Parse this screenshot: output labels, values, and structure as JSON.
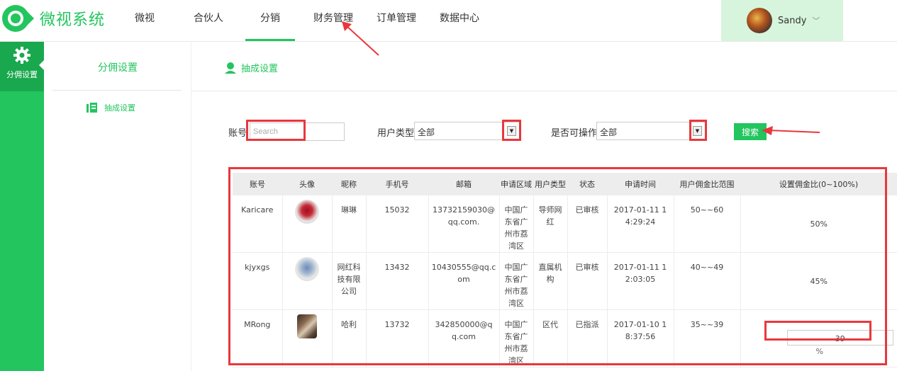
{
  "header": {
    "logo_text": "微视系统",
    "nav": [
      "微视",
      "合伙人",
      "分销",
      "财务管理",
      "订单管理",
      "数据中心"
    ],
    "user_name": "Sandy"
  },
  "sidebar": {
    "item_label": "分佣设置"
  },
  "subnav": {
    "title": "分佣设置",
    "item_label": "抽成设置"
  },
  "main": {
    "section_title": "抽成设置"
  },
  "filter": {
    "account_label": "账号",
    "account_placeholder": "Search",
    "user_type_label": "用户类型",
    "user_type_value": "全部",
    "operable_label": "是否可操作",
    "operable_value": "全部",
    "search_button": "搜索"
  },
  "table": {
    "columns": [
      "账号",
      "头像",
      "昵称",
      "手机号",
      "邮箱",
      "申请区域",
      "用户类型",
      "状态",
      "申请时间",
      "用户佣金比范围",
      "设置佣金比(0~100%)"
    ],
    "rows": [
      {
        "account": "Karicare",
        "nickname": "琳琳",
        "phone": "15032",
        "email": "13732159030@qq.com.",
        "region": "中国广东省广州市荔湾区",
        "user_type": "导师网红",
        "status": "已审核",
        "time": "2017-01-11 14:29:24",
        "range": "50~~60",
        "ratio": "50%"
      },
      {
        "account": "kjyxgs",
        "nickname": "网红科技有限公司",
        "phone": "13432",
        "email": "10430555@qq.com",
        "region": "中国广东省广州市荔湾区",
        "user_type": "直属机构",
        "status": "已审核",
        "time": "2017-01-11 12:03:05",
        "range": "40~~49",
        "ratio": "45%"
      },
      {
        "account": "MRong",
        "nickname": "哈利",
        "phone": "13732",
        "email": "342850000@qq.com",
        "region": "中国广东省广州市荔湾区",
        "user_type": "区代",
        "status": "已指派",
        "time": "2017-01-10 18:37:56",
        "range": "35~~39",
        "ratio": "39",
        "ratio_suffix": "%"
      }
    ]
  },
  "colors": {
    "accent": "#22c55e",
    "annotation": "#e8383d"
  }
}
